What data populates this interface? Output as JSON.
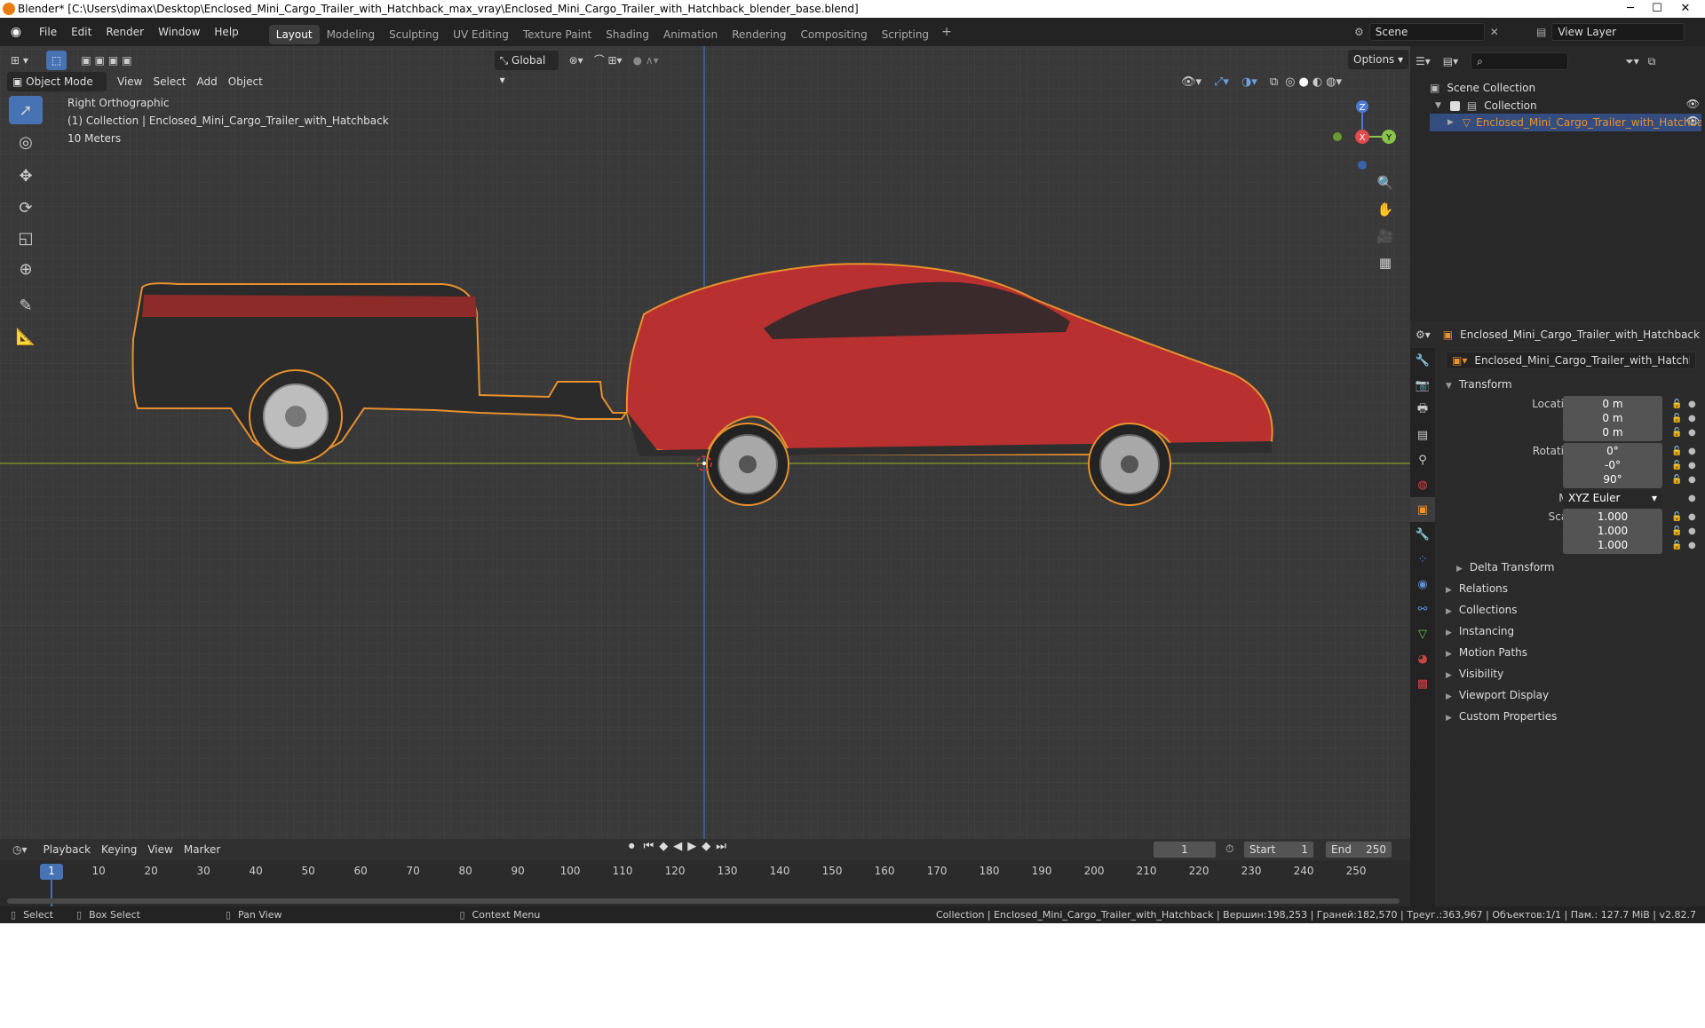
{
  "window": {
    "title": "Blender* [C:\\Users\\dimax\\Desktop\\Enclosed_Mini_Cargo_Trailer_with_Hatchback_max_vray\\Enclosed_Mini_Cargo_Trailer_with_Hatchback_blender_base.blend]"
  },
  "menu": [
    "File",
    "Edit",
    "Render",
    "Window",
    "Help"
  ],
  "workspaces": [
    "Layout",
    "Modeling",
    "Sculpting",
    "UV Editing",
    "Texture Paint",
    "Shading",
    "Animation",
    "Rendering",
    "Compositing",
    "Scripting"
  ],
  "active_workspace": "Layout",
  "topright": {
    "scene": "Scene",
    "view_layer": "View Layer"
  },
  "viewport": {
    "transform_orientation": "Global",
    "options_label": "Options",
    "mode": "Object Mode",
    "menus": [
      "View",
      "Select",
      "Add",
      "Object"
    ],
    "overlay_lines": [
      "Right Orthographic",
      "(1) Collection | Enclosed_Mini_Cargo_Trailer_with_Hatchback",
      "10 Meters"
    ],
    "gizmo": {
      "z": "Z",
      "x": "X",
      "y": "Y"
    }
  },
  "outliner": {
    "root": "Scene Collection",
    "collection": "Collection",
    "object": "Enclosed_Mini_Cargo_Trailer_with_Hatchback"
  },
  "properties": {
    "object_name": "Enclosed_Mini_Cargo_Trailer_with_Hatchback",
    "data_name": "Enclosed_Mini_Cargo_Trailer_with_Hatchback",
    "transform_label": "Transform",
    "location": {
      "label": "Location X",
      "x": "0 m",
      "y": "0 m",
      "z": "0 m"
    },
    "rotation": {
      "label": "Rotation X",
      "x": "0°",
      "y": "-0°",
      "z": "90°"
    },
    "mode_label": "Mode",
    "mode_value": "XYZ Euler",
    "scale": {
      "label": "Scale X",
      "x": "1.000",
      "y": "1.000",
      "z": "1.000"
    },
    "axis_y": "Y",
    "axis_z": "Z",
    "delta": "Delta Transform",
    "panels": [
      "Relations",
      "Collections",
      "Instancing",
      "Motion Paths",
      "Visibility",
      "Viewport Display",
      "Custom Properties"
    ]
  },
  "timeline": {
    "menus": [
      "Playback",
      "Keying",
      "View",
      "Marker"
    ],
    "current_frame": "1",
    "start_label": "Start",
    "start": "1",
    "end_label": "End",
    "end": "250",
    "ticks": [
      "1",
      "10",
      "20",
      "30",
      "40",
      "50",
      "60",
      "70",
      "80",
      "90",
      "100",
      "110",
      "120",
      "130",
      "140",
      "150",
      "160",
      "170",
      "180",
      "190",
      "200",
      "210",
      "220",
      "230",
      "240",
      "250"
    ]
  },
  "statusbar": {
    "select": "Select",
    "box_select": "Box Select",
    "pan_view": "Pan View",
    "context_menu": "Context Menu",
    "info": "Collection | Enclosed_Mini_Cargo_Trailer_with_Hatchback | Вершин:198,253 | Граней:182,570 | Треуг.:363,967 | Объектов:1/1 | Пам.: 127.7 MiB | v2.82.7"
  },
  "colors": {
    "accent": "#4772b3",
    "selection": "#e8912d",
    "car": "#b8302f"
  }
}
